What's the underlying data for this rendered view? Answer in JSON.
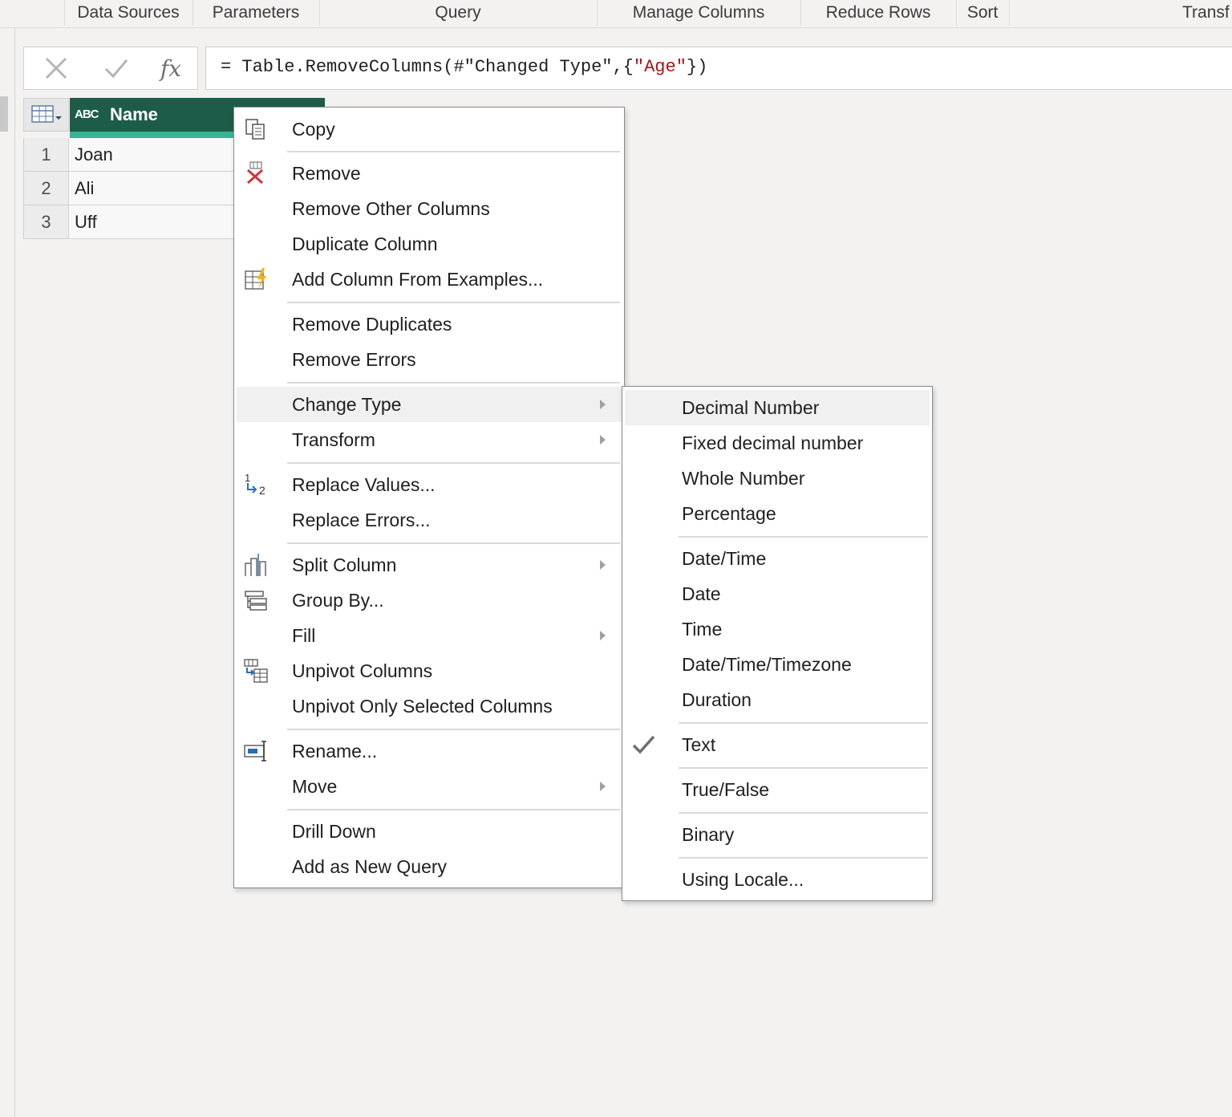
{
  "ribbon": {
    "groups": [
      "Data Sources",
      "Parameters",
      "Query",
      "Manage Columns",
      "Reduce Rows",
      "Sort",
      "Transf"
    ]
  },
  "formula_bar": {
    "cancel_icon": "x-icon",
    "commit_icon": "check-icon",
    "fx_label": "fx",
    "prefix": "= Table.RemoveColumns(#\"Changed Type\",{",
    "string_value": "\"Age\"",
    "suffix": "})"
  },
  "grid": {
    "type_indicator": "ABC",
    "column_header": "Name",
    "rows": [
      {
        "index": "1",
        "value": "Joan"
      },
      {
        "index": "2",
        "value": "Ali"
      },
      {
        "index": "3",
        "value": "Uff"
      }
    ]
  },
  "context_menu": {
    "items": [
      {
        "label": "Copy",
        "icon": "copy-icon"
      },
      {
        "label": "Remove",
        "icon": "remove-column-icon"
      },
      {
        "label": "Remove Other Columns"
      },
      {
        "label": "Duplicate Column"
      },
      {
        "label": "Add Column From Examples...",
        "icon": "column-from-examples-icon"
      },
      {
        "label": "Remove Duplicates"
      },
      {
        "label": "Remove Errors"
      },
      {
        "label": "Change Type",
        "submenu": true
      },
      {
        "label": "Transform",
        "submenu": true
      },
      {
        "label": "Replace Values...",
        "icon": "replace-values-icon"
      },
      {
        "label": "Replace Errors..."
      },
      {
        "label": "Split Column",
        "icon": "split-column-icon",
        "submenu": true
      },
      {
        "label": "Group By...",
        "icon": "group-by-icon"
      },
      {
        "label": "Fill",
        "submenu": true
      },
      {
        "label": "Unpivot Columns",
        "icon": "unpivot-icon"
      },
      {
        "label": "Unpivot Only Selected Columns"
      },
      {
        "label": "Rename...",
        "icon": "rename-icon"
      },
      {
        "label": "Move",
        "submenu": true
      },
      {
        "label": "Drill Down"
      },
      {
        "label": "Add as New Query"
      }
    ]
  },
  "type_submenu": {
    "items": [
      {
        "label": "Decimal Number"
      },
      {
        "label": "Fixed decimal number"
      },
      {
        "label": "Whole Number"
      },
      {
        "label": "Percentage"
      },
      {
        "label": "Date/Time"
      },
      {
        "label": "Date"
      },
      {
        "label": "Time"
      },
      {
        "label": "Date/Time/Timezone"
      },
      {
        "label": "Duration"
      },
      {
        "label": "Text",
        "checked": true
      },
      {
        "label": "True/False"
      },
      {
        "label": "Binary"
      },
      {
        "label": "Using Locale..."
      }
    ]
  },
  "colors": {
    "header_bg": "#1e5c4a",
    "header_underline": "#37b494",
    "remove_icon_red": "#d13438",
    "formula_string": "#a31515"
  }
}
